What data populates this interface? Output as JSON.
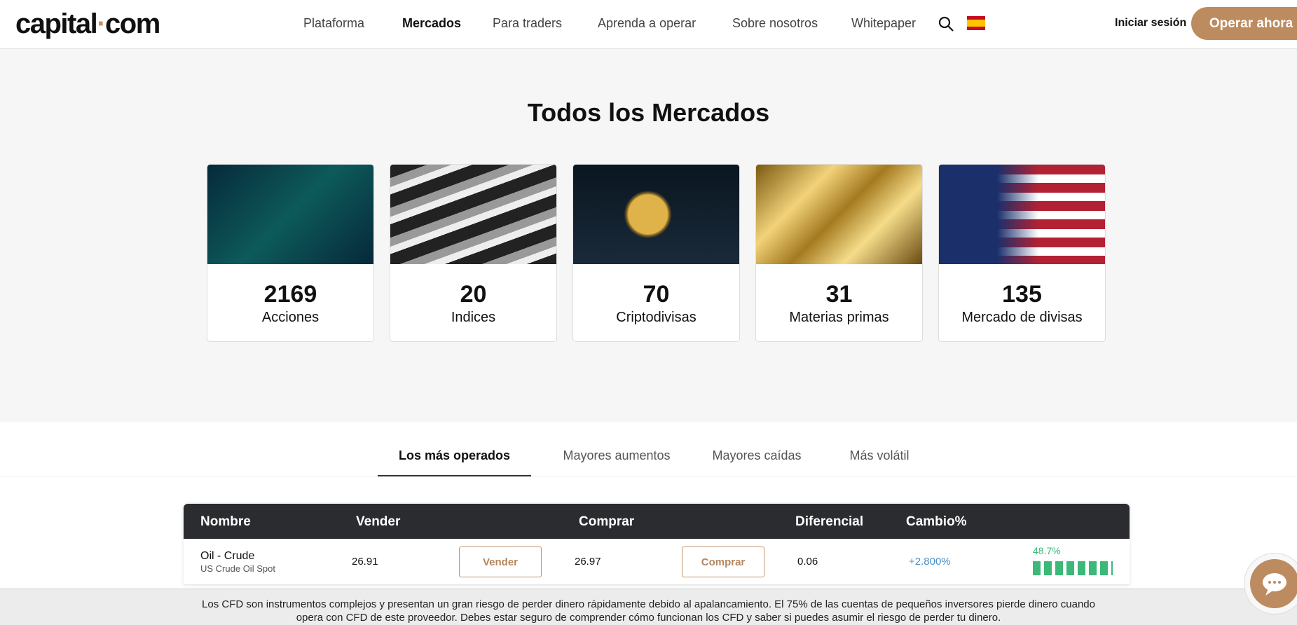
{
  "header": {
    "logo": "capital",
    "logo_dot": "·",
    "logo_suffix": "com",
    "nav": [
      "Plataforma",
      "Mercados",
      "Para traders",
      "Aprenda a operar",
      "Sobre nosotros",
      "Whitepaper"
    ],
    "login": "Iniciar sesión",
    "cta": "Operar ahora",
    "language": "es"
  },
  "hero": {
    "title": "Todos los Mercados",
    "cards": [
      {
        "count": "2169",
        "label": "Acciones"
      },
      {
        "count": "20",
        "label": "Indices"
      },
      {
        "count": "70",
        "label": "Criptodivisas"
      },
      {
        "count": "31",
        "label": "Materias primas"
      },
      {
        "count": "135",
        "label": "Mercado de divisas"
      }
    ]
  },
  "tabs": [
    "Los más operados",
    "Mayores aumentos",
    "Mayores caídas",
    "Más volátil"
  ],
  "table": {
    "headers": [
      "Nombre",
      "Vender",
      "Comprar",
      "Diferencial",
      "Cambio%"
    ],
    "rows": [
      {
        "name": "Oil - Crude",
        "subname": "US Crude Oil Spot",
        "sell": "26.91",
        "sell_btn": "Vender",
        "buy": "26.97",
        "buy_btn": "Comprar",
        "spread": "0.06",
        "change": "+2.800%",
        "sentiment": "48.7%"
      }
    ]
  },
  "colors": {
    "accent": "#bd8b60",
    "positive": "#4a90c8",
    "sentiment": "#3cb878"
  },
  "footer": {
    "disclaimer": "Los CFD son instrumentos complejos y presentan un gran riesgo de perder dinero rápidamente debido al apalancamiento. El 75% de las cuentas de pequeños inversores pierde dinero cuando opera con CFD de este proveedor. Debes estar seguro de comprender cómo funcionan los CFD y saber si puedes asumir el riesgo de perder tu dinero."
  }
}
